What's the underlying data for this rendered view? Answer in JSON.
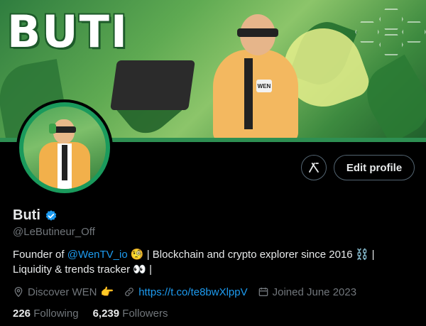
{
  "banner": {
    "title": "BUTI",
    "badge": "WEN"
  },
  "actions": {
    "grok_label": "𝑿/",
    "edit_profile": "Edit profile"
  },
  "profile": {
    "display_name": "Buti",
    "handle": "@LeButineur_Off",
    "bio_part1": "Founder of ",
    "bio_mention": "@WenTV_io",
    "bio_emoji1": " 🧐",
    "bio_part2": " | Blockchain and crypto explorer since 2016 ⛓️ |",
    "bio_part3": "Liquidity & trends tracker 👀 |",
    "location": "Discover WEN",
    "location_emoji": "👉",
    "website": "https://t.co/te8bwXlppV",
    "joined": "Joined June 2023",
    "following_count": "226",
    "following_label": "Following",
    "followers_count": "6,239",
    "followers_label": "Followers"
  },
  "colors": {
    "accent": "#1d9bf0",
    "muted": "#71767b",
    "text": "#e7e9ea",
    "background": "#000000"
  }
}
